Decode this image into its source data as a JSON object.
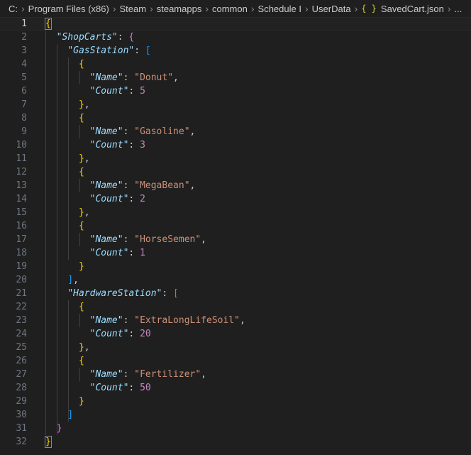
{
  "breadcrumb": {
    "items": [
      "C:",
      "Program Files (x86)",
      "Steam",
      "steamapps",
      "common",
      "Schedule I",
      "UserData"
    ],
    "file_icon": "{ }",
    "file_name": "SavedCart.json",
    "ellipsis": "..."
  },
  "editor": {
    "active_line": 1,
    "lines": [
      {
        "no": "1"
      },
      {
        "no": "2"
      },
      {
        "no": "3"
      },
      {
        "no": "4"
      },
      {
        "no": "5"
      },
      {
        "no": "6"
      },
      {
        "no": "7"
      },
      {
        "no": "8"
      },
      {
        "no": "9"
      },
      {
        "no": "10"
      },
      {
        "no": "11"
      },
      {
        "no": "12"
      },
      {
        "no": "13"
      },
      {
        "no": "14"
      },
      {
        "no": "15"
      },
      {
        "no": "16"
      },
      {
        "no": "17"
      },
      {
        "no": "18"
      },
      {
        "no": "19"
      },
      {
        "no": "20"
      },
      {
        "no": "21"
      },
      {
        "no": "22"
      },
      {
        "no": "23"
      },
      {
        "no": "24"
      },
      {
        "no": "25"
      },
      {
        "no": "26"
      },
      {
        "no": "27"
      },
      {
        "no": "28"
      },
      {
        "no": "29"
      },
      {
        "no": "30"
      },
      {
        "no": "31"
      },
      {
        "no": "32"
      }
    ],
    "keys": {
      "root": "\"ShopCarts\"",
      "gas": "\"GasStation\"",
      "hardware": "\"HardwareStation\"",
      "name": "\"Name\"",
      "count": "\"Count\""
    },
    "gas_items": [
      {
        "name": "\"Donut\"",
        "count": "5"
      },
      {
        "name": "\"Gasoline\"",
        "count": "3"
      },
      {
        "name": "\"MegaBean\"",
        "count": "2"
      },
      {
        "name": "\"HorseSemen\"",
        "count": "1"
      }
    ],
    "hardware_items": [
      {
        "name": "\"ExtraLongLifeSoil\"",
        "count": "20"
      },
      {
        "name": "\"Fertilizer\"",
        "count": "50"
      }
    ]
  },
  "colors": {
    "background": "#1f1f1f",
    "key": "#9cdcfe",
    "string": "#ce9178",
    "number": "#b5cea8",
    "bracket_level1": "#ffd700",
    "bracket_level2": "#da70d6",
    "bracket_level3": "#179fff"
  }
}
